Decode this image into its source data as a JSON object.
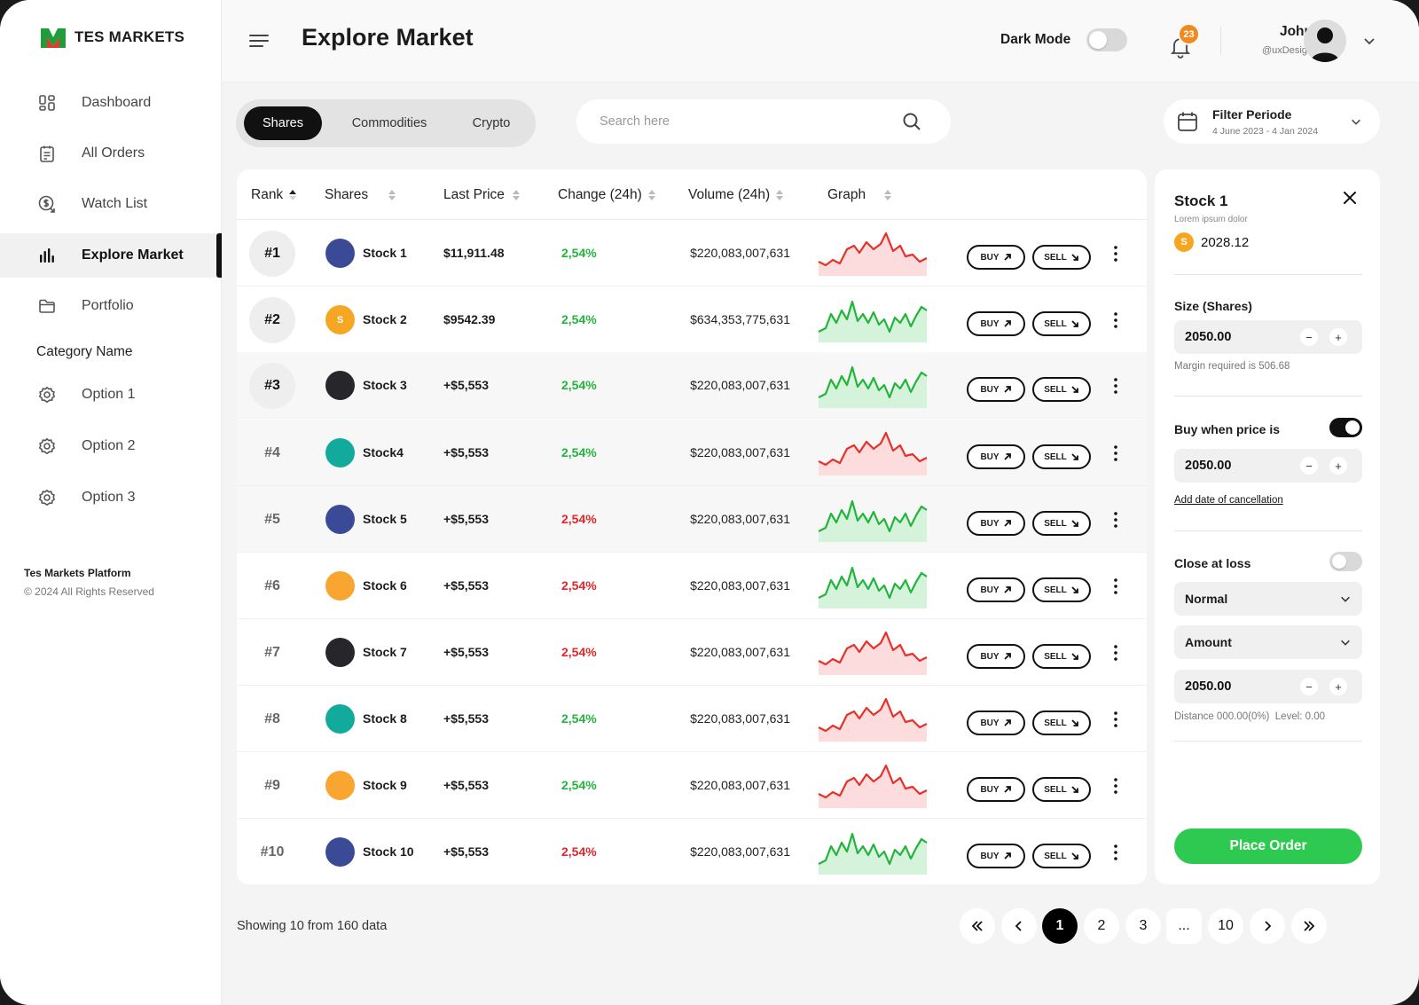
{
  "brand": {
    "name": "TES MARKETS"
  },
  "sidebar": {
    "items": [
      {
        "label": "Dashboard",
        "icon": "dashboard-icon"
      },
      {
        "label": "All Orders",
        "icon": "clipboard-icon"
      },
      {
        "label": "Watch List",
        "icon": "dollar-refresh-icon"
      },
      {
        "label": "Explore Market",
        "icon": "bar-chart-icon",
        "active": true
      },
      {
        "label": "Portfolio",
        "icon": "folder-icon"
      }
    ],
    "category_title": "Category Name",
    "options": [
      {
        "label": "Option 1",
        "icon": "gear-icon"
      },
      {
        "label": "Option 2",
        "icon": "gear-icon"
      },
      {
        "label": "Option 3",
        "icon": "gear-icon"
      }
    ],
    "footer_title": "Tes Markets Platform",
    "footer_copy": "© 2024 All Rights Reserved"
  },
  "header": {
    "title": "Explore Market",
    "dark_mode_label": "Dark Mode",
    "dark_mode_on": false,
    "notification_count": "23",
    "user_name": "John",
    "user_handle": "@uxDesign"
  },
  "toolbar": {
    "tabs": [
      "Shares",
      "Commodities",
      "Crypto"
    ],
    "active_tab": "Shares",
    "search_placeholder": "Search here",
    "filter_title": "Filter Periode",
    "filter_range": "4 June 2023 - 4 Jan 2024"
  },
  "table": {
    "columns": [
      "Rank",
      "Shares",
      "Last Price",
      "Change (24h)",
      "Volume (24h)",
      "Graph"
    ],
    "buy_label": "BUY",
    "sell_label": "SELL",
    "rows": [
      {
        "rank": "#1",
        "name": "Stock 1",
        "price": "$11,911.48",
        "change": "2,54%",
        "change_dir": "up",
        "volume": "$220,083,007,631",
        "coin_color": "#3b4a97",
        "coin_letter": "",
        "trend": "red",
        "rank_style": "circle"
      },
      {
        "rank": "#2",
        "name": "Stock 2",
        "price": "$9542.39",
        "change": "2,54%",
        "change_dir": "up",
        "volume": "$634,353,775,631",
        "coin_color": "#f5a623",
        "coin_letter": "S",
        "trend": "green",
        "rank_style": "circle"
      },
      {
        "rank": "#3",
        "name": "Stock 3",
        "price": "+$5,553",
        "change": "2,54%",
        "change_dir": "up",
        "volume": "$220,083,007,631",
        "coin_color": "#26262b",
        "coin_letter": "",
        "trend": "green",
        "rank_style": "circle"
      },
      {
        "rank": "#4",
        "name": "Stock4",
        "price": "+$5,553",
        "change": "2,54%",
        "change_dir": "up",
        "volume": "$220,083,007,631",
        "coin_color": "#12aa9c",
        "coin_letter": "",
        "trend": "red",
        "rank_style": "plain"
      },
      {
        "rank": "#5",
        "name": "Stock 5",
        "price": "+$5,553",
        "change": "2,54%",
        "change_dir": "down",
        "volume": "$220,083,007,631",
        "coin_color": "#3b4a97",
        "coin_letter": "",
        "trend": "green",
        "rank_style": "plain"
      },
      {
        "rank": "#6",
        "name": "Stock 6",
        "price": "+$5,553",
        "change": "2,54%",
        "change_dir": "down",
        "volume": "$220,083,007,631",
        "coin_color": "#f9a630",
        "coin_letter": "",
        "trend": "green",
        "rank_style": "plain"
      },
      {
        "rank": "#7",
        "name": "Stock 7",
        "price": "+$5,553",
        "change": "2,54%",
        "change_dir": "down",
        "volume": "$220,083,007,631",
        "coin_color": "#26262b",
        "coin_letter": "",
        "trend": "red",
        "rank_style": "plain"
      },
      {
        "rank": "#8",
        "name": "Stock 8",
        "price": "+$5,553",
        "change": "2,54%",
        "change_dir": "up",
        "volume": "$220,083,007,631",
        "coin_color": "#12aa9c",
        "coin_letter": "",
        "trend": "red",
        "rank_style": "plain"
      },
      {
        "rank": "#9",
        "name": "Stock 9",
        "price": "+$5,553",
        "change": "2,54%",
        "change_dir": "up",
        "volume": "$220,083,007,631",
        "coin_color": "#f9a630",
        "coin_letter": "",
        "trend": "red",
        "rank_style": "plain"
      },
      {
        "rank": "#10",
        "name": "Stock 10",
        "price": "+$5,553",
        "change": "2,54%",
        "change_dir": "down",
        "volume": "$220,083,007,631",
        "coin_color": "#3b4a97",
        "coin_letter": "",
        "trend": "green",
        "rank_style": "plain"
      }
    ]
  },
  "pagination": {
    "showing": "Showing 10 from 160 data",
    "pages": [
      "1",
      "2",
      "3",
      "...",
      "10"
    ],
    "current": "1"
  },
  "order_panel": {
    "title": "Stock 1",
    "subtitle": "Lorem ipsum dolor",
    "coin_letter": "S",
    "price": "2028.12",
    "size_label": "Size (Shares)",
    "size_value": "2050.00",
    "margin_text": "Margin required is 506.68",
    "buy_when_label": "Buy when price is",
    "buy_when_on": true,
    "buy_when_value": "2050.00",
    "add_date_link": "Add date of cancellation",
    "close_loss_label": "Close at loss",
    "close_loss_on": false,
    "select_type": "Normal",
    "select_mode": "Amount",
    "amount_value": "2050.00",
    "distance_text": "Distance 000.00(0%)  Level: 0.00",
    "place_order": "Place Order"
  },
  "colors": {
    "accent_green": "#2ec950",
    "up": "#22b53c",
    "down": "#e0272b",
    "badge": "#f08a1e"
  }
}
